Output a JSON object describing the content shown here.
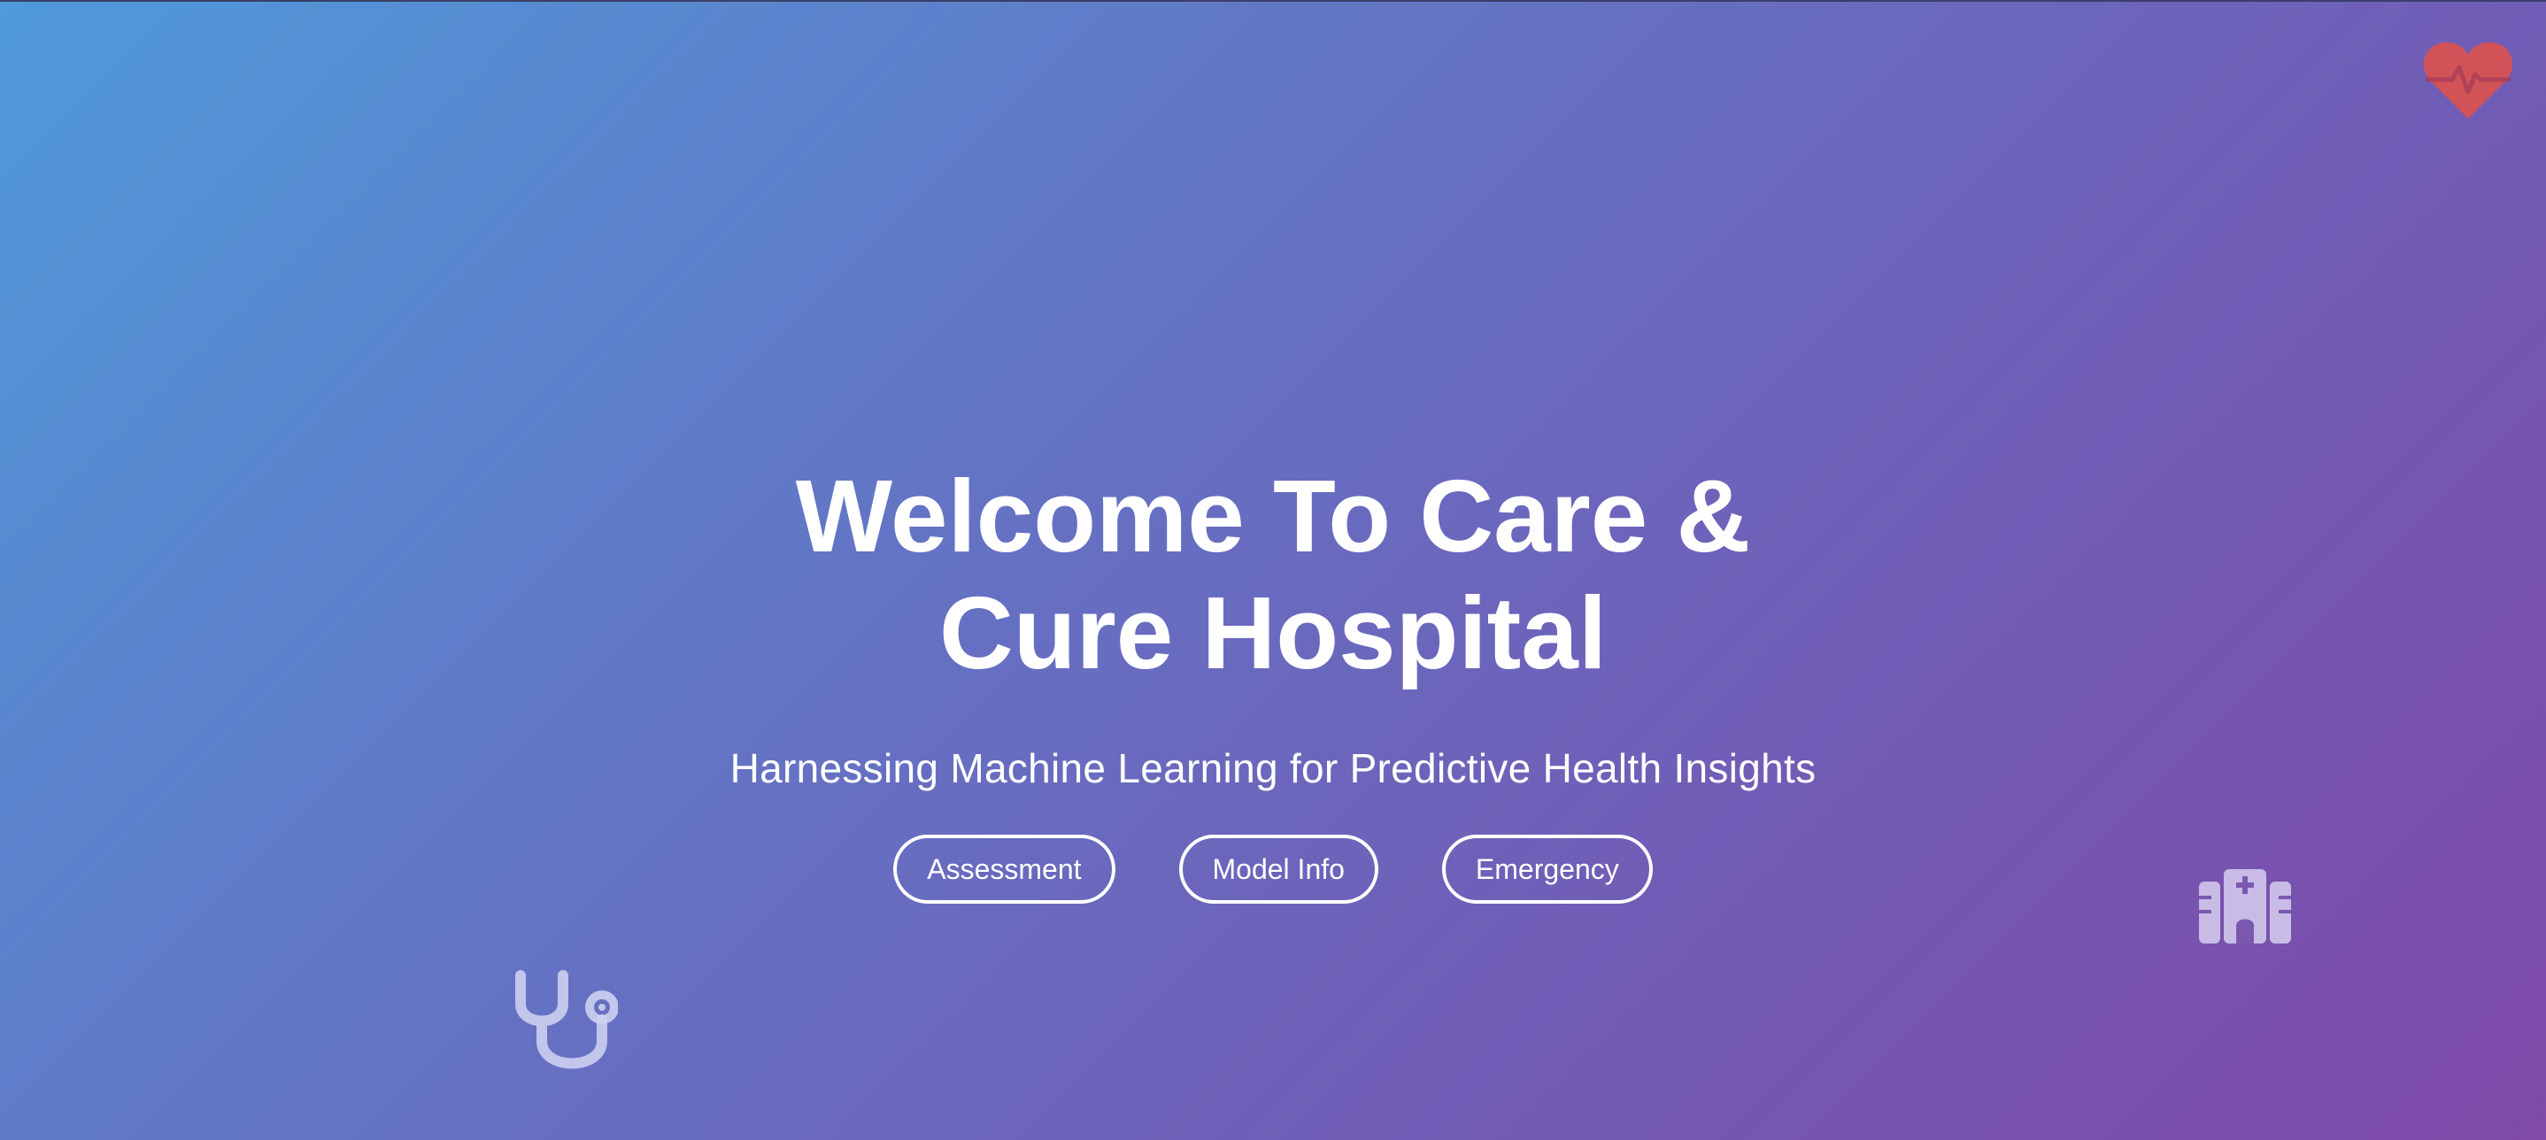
{
  "hero": {
    "title": "Welcome To Care & Cure Hospital",
    "subtitle": "Harnessing Machine Learning for Predictive Health Insights",
    "buttons": {
      "assessment": "Assessment",
      "model_info": "Model Info",
      "emergency": "Emergency"
    }
  },
  "icons": {
    "top_right": "heartbeat-icon",
    "bottom_left": "stethoscope-icon",
    "bottom_right": "hospital-icon"
  },
  "colors": {
    "gradient_start": "#4f9ad9",
    "gradient_end": "#7f4aa8",
    "heart": "#d9534f",
    "text": "#ffffff",
    "decor_icon": "#cdd0f0"
  }
}
